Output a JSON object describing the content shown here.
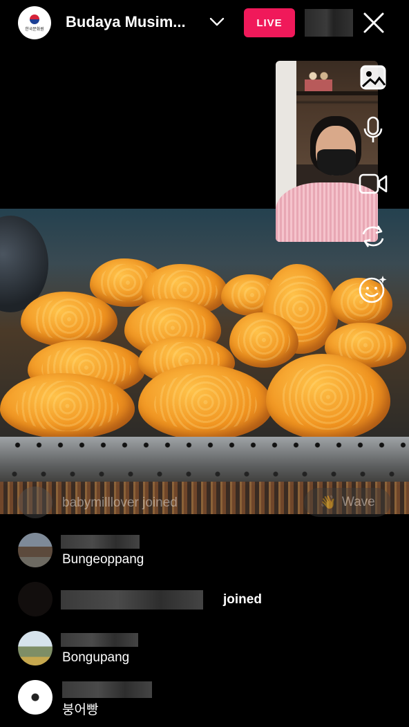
{
  "header": {
    "account_name": "Budaya Musim...",
    "avatar_text": "한국문화원",
    "live_label": "LIVE",
    "viewer_count": ""
  },
  "overlay": {
    "join_message": "babymilllover joined",
    "wave_label": "Wave",
    "wave_emoji": "👋"
  },
  "comments": [
    {
      "username": "",
      "text": "Bungeoppang"
    },
    {
      "username": "",
      "text": "joined"
    },
    {
      "username": "",
      "text": "Bongupang"
    },
    {
      "username": "",
      "text": "붕어빵"
    }
  ],
  "side_controls": [
    "image-icon",
    "microphone-icon",
    "video-camera-icon",
    "flip-camera-icon",
    "effects-face-icon"
  ],
  "colors": {
    "live_badge": "#f0195a",
    "background": "#000000"
  }
}
